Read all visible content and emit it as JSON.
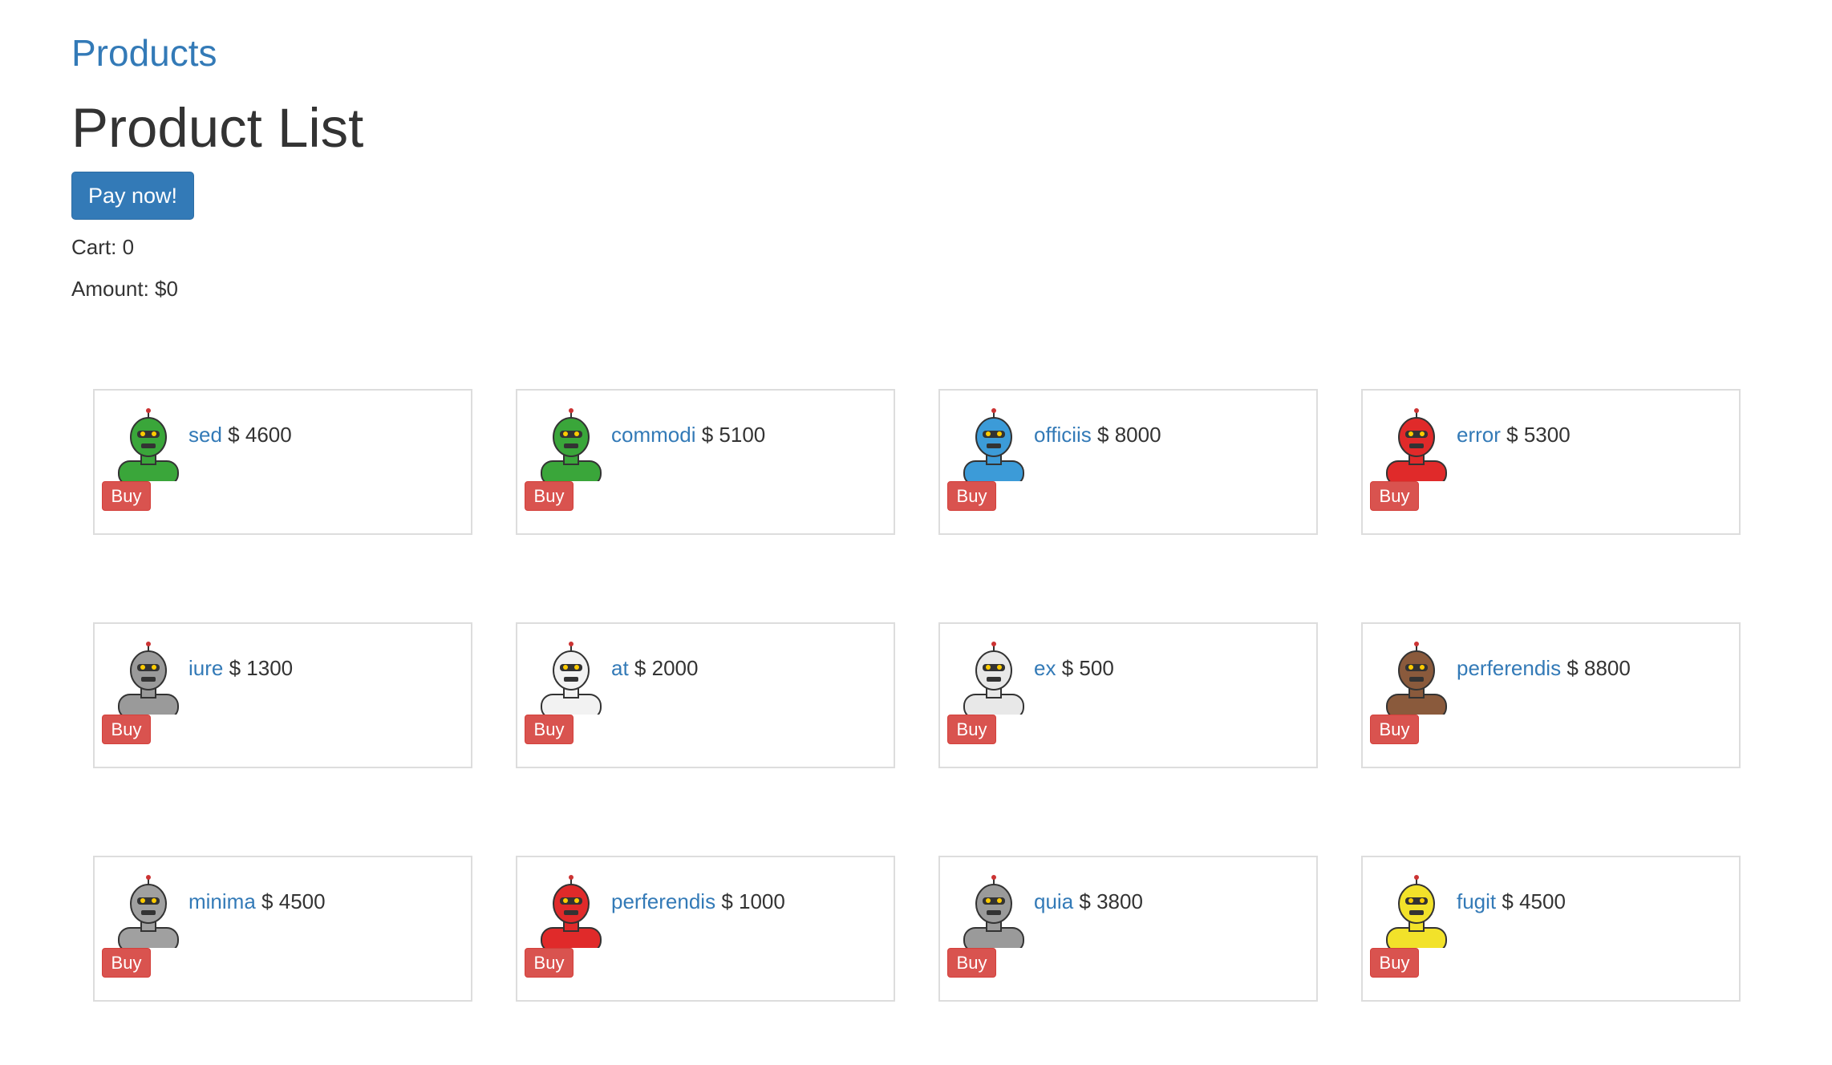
{
  "header": {
    "brand": "Products",
    "title": "Product List"
  },
  "pay_button": "Pay now!",
  "cart": {
    "label": "Cart: 0",
    "amount": "Amount: $0"
  },
  "currency": "$",
  "buy_label": "Buy",
  "colors": {
    "link": "#337ab7",
    "primary": "#337ab7",
    "danger": "#d9534f",
    "border": "#dddddd"
  },
  "products": [
    {
      "name": "sed",
      "price": "4600",
      "avatar": "robot-green-icon",
      "color": "#3aa63a"
    },
    {
      "name": "commodi",
      "price": "5100",
      "avatar": "robot-green-antenna-icon",
      "color": "#3aa63a"
    },
    {
      "name": "officiis",
      "price": "8000",
      "avatar": "robot-blue-icon",
      "color": "#3c9bd8"
    },
    {
      "name": "error",
      "price": "5300",
      "avatar": "robot-red-icon",
      "color": "#e02a2a"
    },
    {
      "name": "iure",
      "price": "1300",
      "avatar": "robot-gray-icon",
      "color": "#9a9a9a"
    },
    {
      "name": "at",
      "price": "2000",
      "avatar": "robot-white-icon",
      "color": "#f2f2f2"
    },
    {
      "name": "ex",
      "price": "500",
      "avatar": "robot-white-grin-icon",
      "color": "#e8e8e8"
    },
    {
      "name": "perferendis",
      "price": "8800",
      "avatar": "robot-brown-icon",
      "color": "#8a5a3c"
    },
    {
      "name": "minima",
      "price": "4500",
      "avatar": "robot-gray-small-icon",
      "color": "#a0a0a0"
    },
    {
      "name": "perferendis",
      "price": "1000",
      "avatar": "robot-red-antenna-icon",
      "color": "#e02a2a"
    },
    {
      "name": "quia",
      "price": "3800",
      "avatar": "robot-gray-can-icon",
      "color": "#9a9a9a"
    },
    {
      "name": "fugit",
      "price": "4500",
      "avatar": "robot-yellow-icon",
      "color": "#f2e22a"
    }
  ]
}
